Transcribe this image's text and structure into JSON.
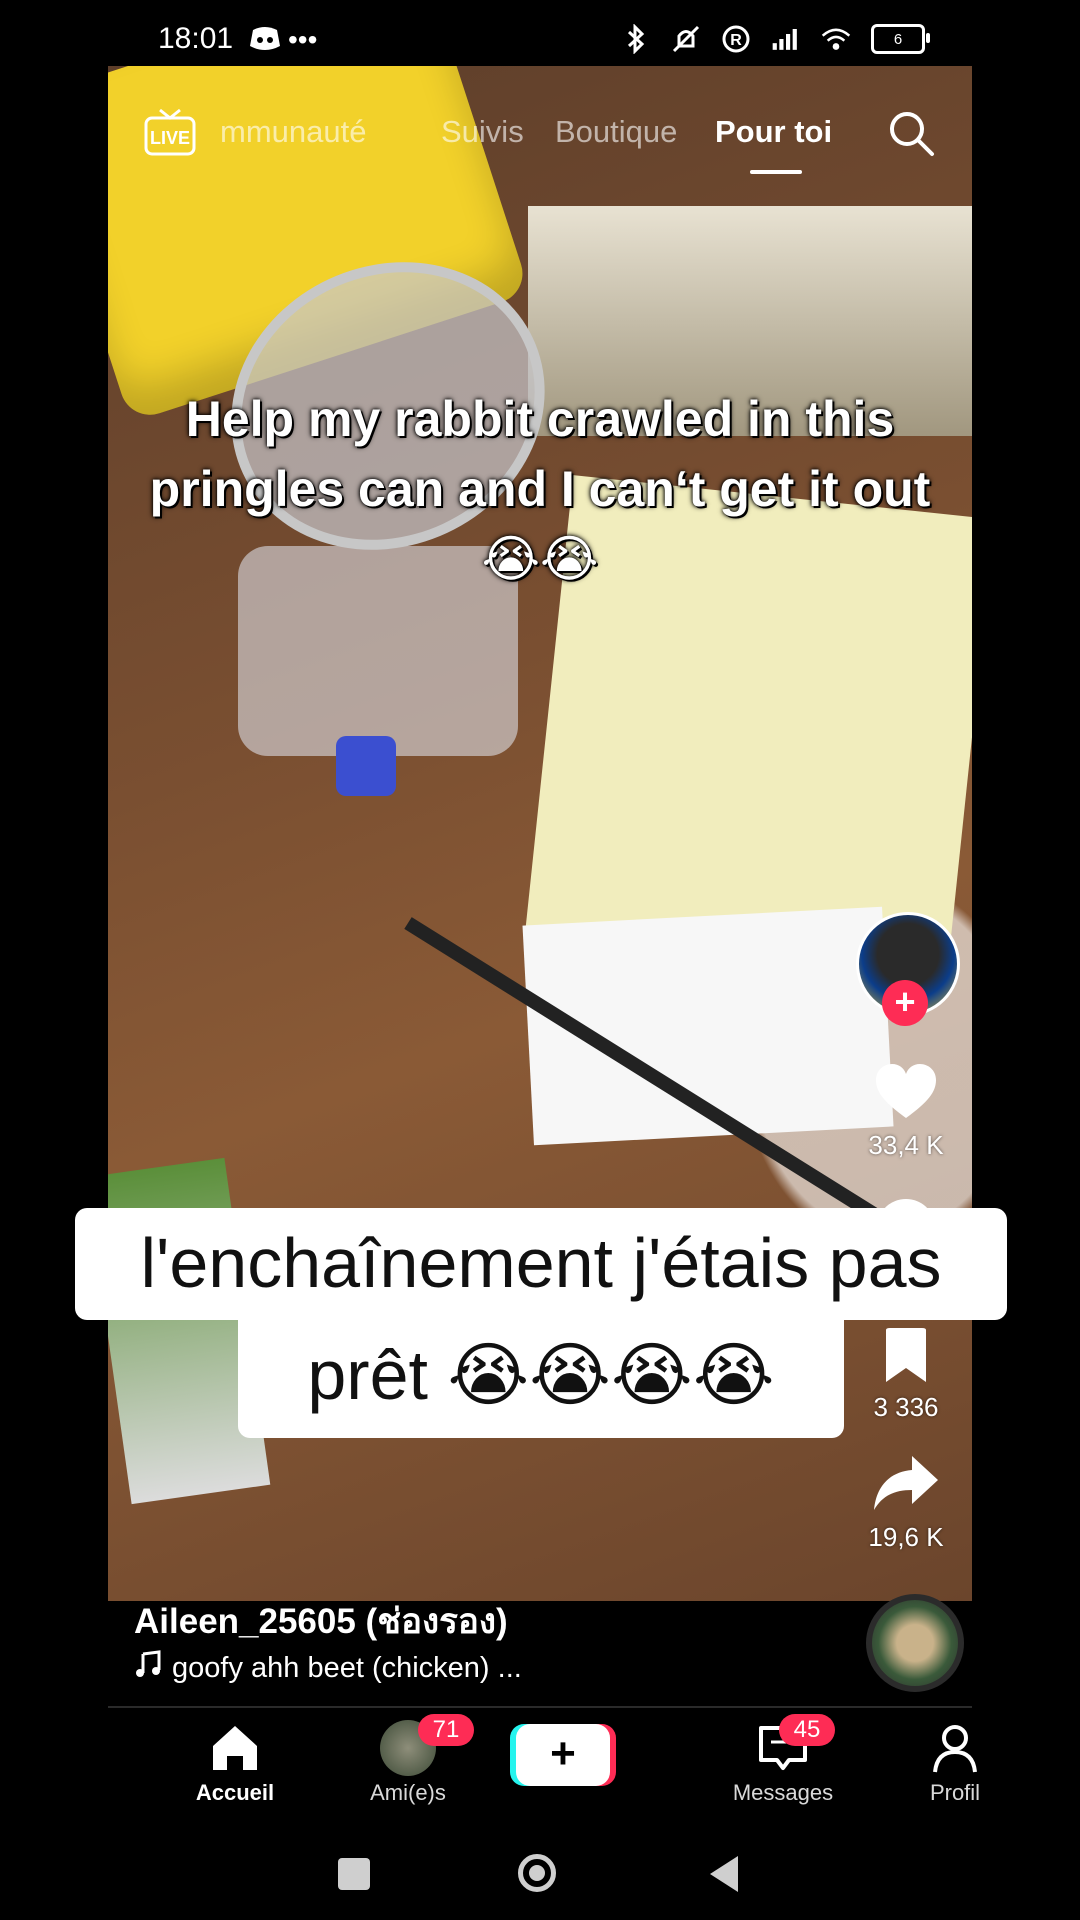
{
  "status_bar": {
    "time": "18:01",
    "battery": "6"
  },
  "top_nav": {
    "live_label": "LIVE",
    "tabs": [
      "mmunauté",
      "Suivis",
      "Boutique",
      "Pour toi"
    ],
    "active_tab": "Pour toi"
  },
  "video": {
    "caption": "Help my rabbit crawled in this pringles can and I can‘t get it out😭😭"
  },
  "actions": {
    "likes": "33,4 K",
    "saves": "3 336",
    "shares": "19,6 K"
  },
  "comment_overlay": {
    "line1": "l'enchaînement j'étais pas",
    "line2": "prêt 😭😭😭😭"
  },
  "author": {
    "name": "Aileen_25605 (ช่องรอง)",
    "music": "goofy ahh beet (chicken) ..."
  },
  "bottom_nav": {
    "home": "Accueil",
    "friends": "Ami(e)s",
    "friends_badge": "71",
    "add": "+",
    "messages": "Messages",
    "messages_badge": "45",
    "profile": "Profil"
  },
  "colors": {
    "accent": "#fe2c55",
    "cyan": "#25f4ee"
  }
}
